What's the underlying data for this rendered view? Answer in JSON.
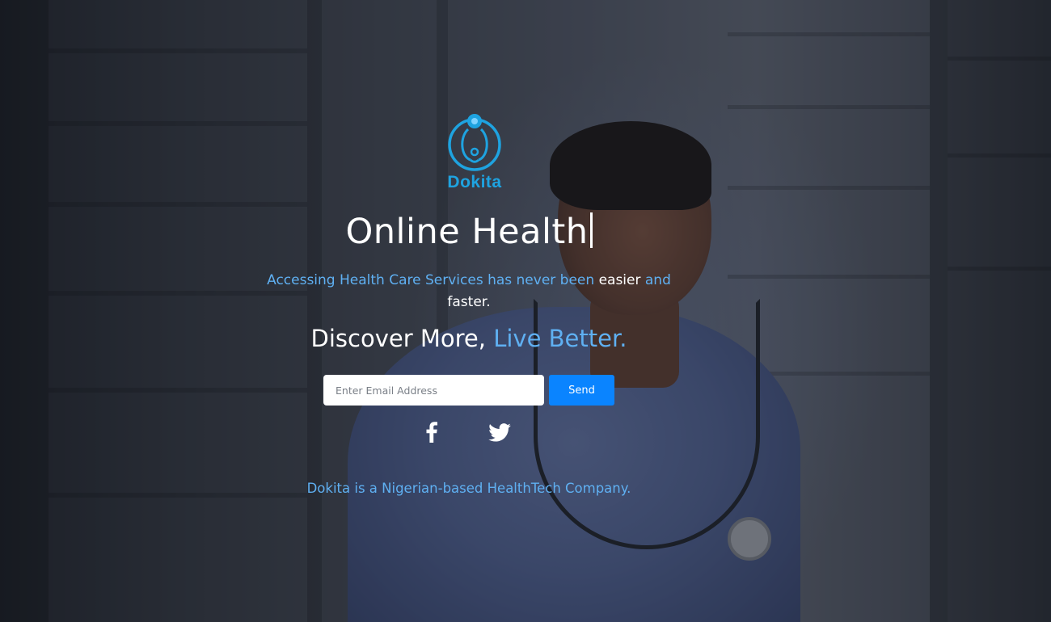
{
  "brand": {
    "name": "Dokita",
    "accent_color": "#1ea3e0",
    "logo_icon": "stethoscope-icon"
  },
  "hero": {
    "headline": "Online Health",
    "tagline_part1": "Accessing Health Care Services has never been ",
    "tagline_highlight1": "easier",
    "tagline_part2": " and ",
    "tagline_highlight2": "faster.",
    "discover_part1": "Discover More, ",
    "discover_part2": "Live Better."
  },
  "subscribe": {
    "email_placeholder": "Enter Email Address",
    "email_value": "",
    "send_label": "Send",
    "button_color": "#0a84ff"
  },
  "social": {
    "items": [
      {
        "icon": "facebook-icon"
      },
      {
        "icon": "twitter-icon"
      }
    ]
  },
  "footer": {
    "note": "Dokita is a Nigerian-based HealthTech Company."
  }
}
